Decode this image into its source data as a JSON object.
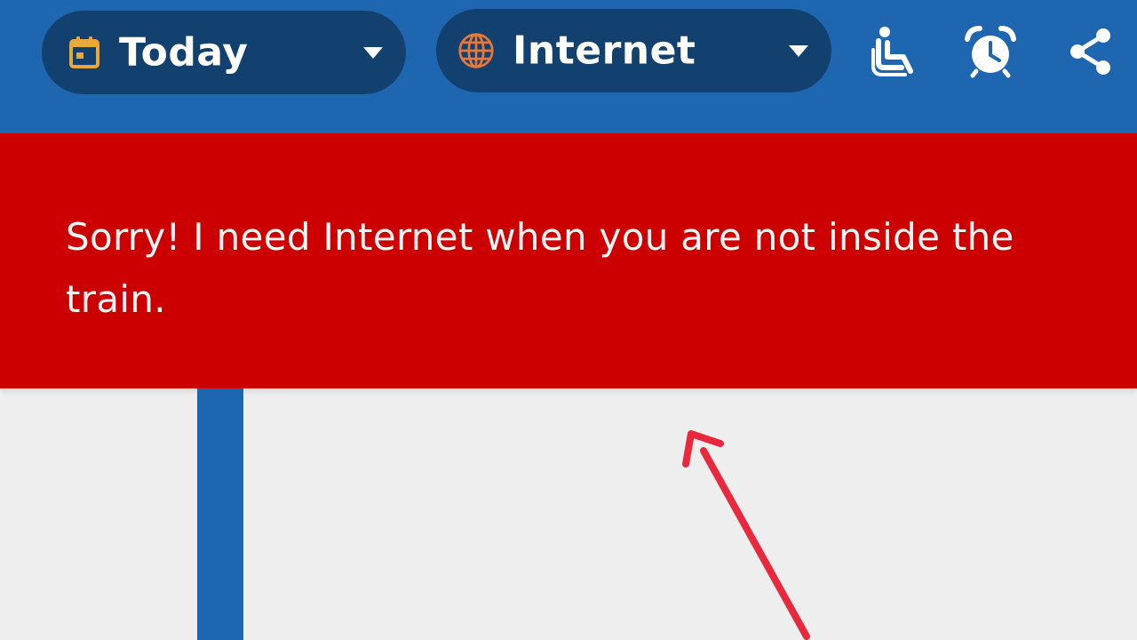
{
  "header": {
    "date_selector": {
      "label": "Today",
      "icon": "calendar-icon",
      "icon_color": "#e9a83a"
    },
    "network_selector": {
      "label": "Internet",
      "icon": "globe-icon",
      "icon_color": "#e7773a"
    },
    "actions": [
      {
        "icon": "seat-icon"
      },
      {
        "icon": "alarm-clock-icon"
      },
      {
        "icon": "share-icon"
      }
    ],
    "background_color": "#1f66b0",
    "pill_color": "#12416f"
  },
  "alert": {
    "message": "Sorry! I need Internet when you are not inside the train.",
    "background_color": "#cc0000"
  },
  "annotation": {
    "arrow_color": "#e8283d"
  }
}
